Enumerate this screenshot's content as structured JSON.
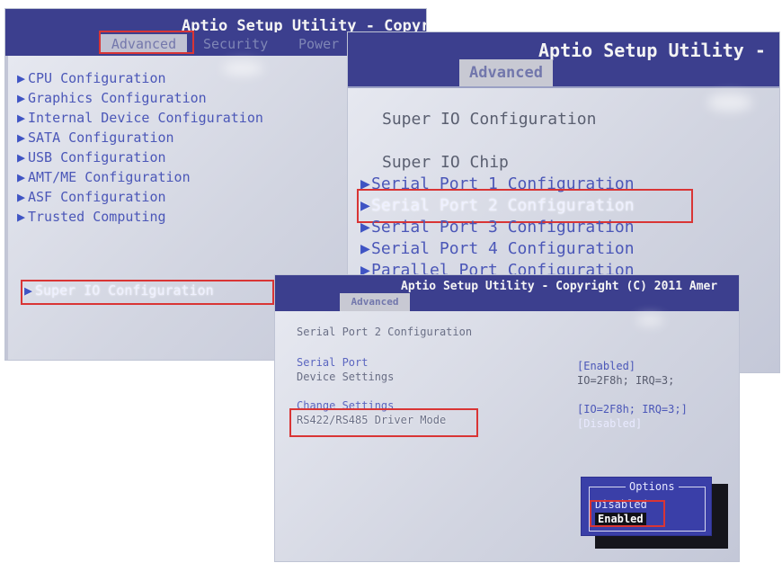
{
  "shot1": {
    "title": "Aptio Setup Utility - Copyr",
    "tabs": [
      "Advanced",
      "Security",
      "Power"
    ],
    "items": [
      "CPU Configuration",
      "Graphics Configuration",
      "Internal Device Configuration",
      "SATA Configuration",
      "USB Configuration",
      "AMT/ME Configuration",
      "ASF Configuration",
      "Trusted Computing"
    ],
    "selected_item": "Super IO Configuration"
  },
  "shot2": {
    "title": "Aptio Setup Utility -",
    "tab": "Advanced",
    "heading": "Super IO Configuration",
    "chip_label": "Super IO Chip",
    "items": [
      "Serial Port 1 Configuration",
      "Serial Port 2 Configuration",
      "Serial Port 3 Configuration",
      "Serial Port 4 Configuration",
      "Parallel Port Configuration"
    ]
  },
  "shot3": {
    "title": "Aptio Setup Utility - Copyright (C) 2011 Amer",
    "tab": "Advanced",
    "heading": "Serial Port 2 Configuration",
    "rows": [
      {
        "label": "Serial Port",
        "value": "[Enabled]"
      },
      {
        "label": "Device Settings",
        "value": "IO=2F8h; IRQ=3;"
      },
      {
        "label": "Change Settings",
        "value": "[IO=2F8h; IRQ=3;]"
      },
      {
        "label": "RS422/RS485 Driver Mode",
        "value": "[Disabled]"
      }
    ],
    "popup": {
      "title": "Options",
      "options": [
        "Disabled",
        "Enabled"
      ]
    }
  },
  "colors": {
    "titlebar": "#3c3f8e",
    "item_text": "#4b57b8",
    "highlight_box": "#d93535",
    "popup_bg": "#3a3fa8"
  },
  "icons": {
    "submenu_arrow": "right-triangle-icon"
  }
}
